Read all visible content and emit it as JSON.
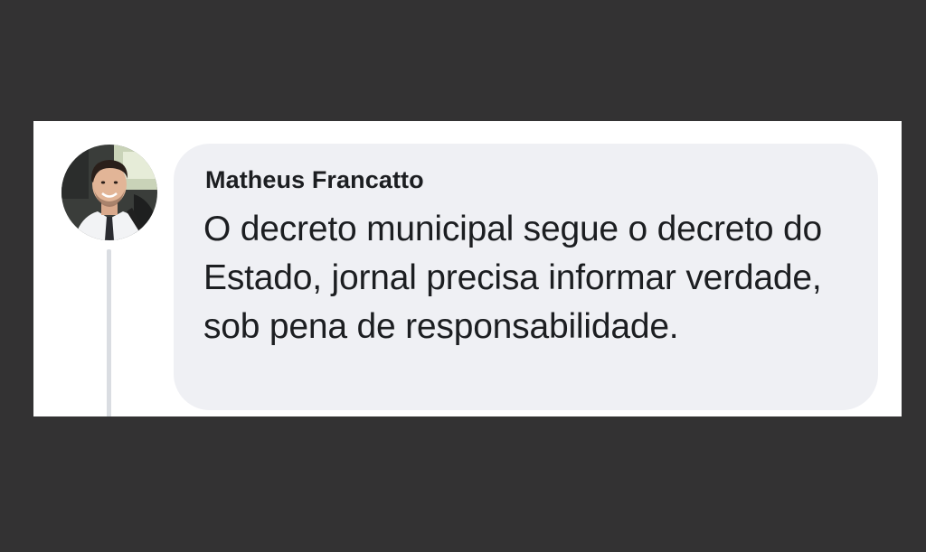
{
  "comment": {
    "author_name": "Matheus Francatto",
    "text": "O decreto municipal segue o decreto do Estado, jornal precisa informar verdade, sob pena de responsabilidade.",
    "avatar_icon": "user-avatar-photo"
  },
  "colors": {
    "outer_background": "#333233",
    "card_background": "#ffffff",
    "bubble_background": "#eff0f4",
    "text": "#1c1e21",
    "thread_line": "#dadde2"
  }
}
